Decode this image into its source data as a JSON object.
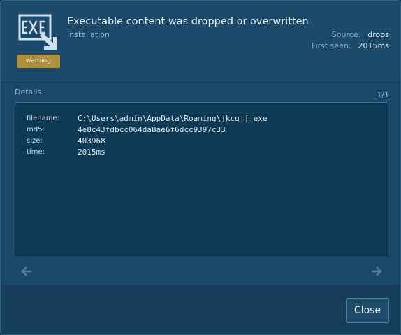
{
  "header": {
    "icon": "exe-file-icon",
    "icon_text": "EXE",
    "severity": "warning",
    "title": "Executable content was dropped or overwritten",
    "category": "Installation",
    "source_label": "Source:",
    "source_value": "drops",
    "first_seen_label": "First seen:",
    "first_seen_value": "2015ms"
  },
  "details": {
    "label": "Details",
    "pager": "1/1",
    "fields": [
      {
        "key": "filename:",
        "value": "C:\\Users\\admin\\AppData\\Roaming\\jkcgjj.exe"
      },
      {
        "key": "md5:",
        "value": "4e8c43fdbcc064da8ae6f6dcc9397c33"
      },
      {
        "key": "size:",
        "value": "403968"
      },
      {
        "key": "time:",
        "value": "2015ms"
      }
    ]
  },
  "nav": {
    "prev_icon": "arrow-left-icon",
    "next_icon": "arrow-right-icon"
  },
  "footer": {
    "close_label": "Close"
  },
  "colors": {
    "dialog_bg": "#1a4868",
    "details_bg": "#0f3a55",
    "badge_bg": "#b08f3e",
    "icon_color": "#cfe2ee"
  }
}
